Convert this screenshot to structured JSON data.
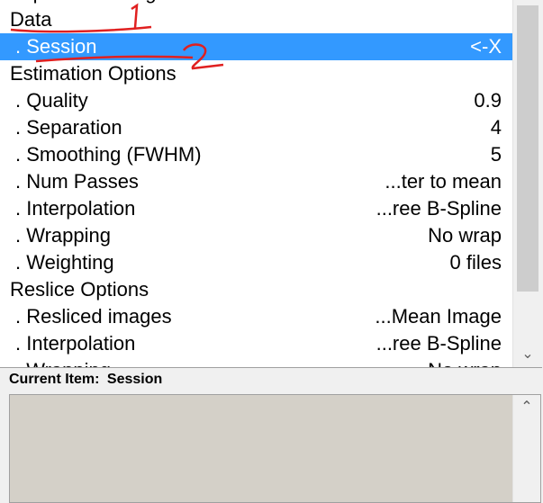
{
  "list": {
    "rows": [
      {
        "label": "Expected Changes",
        "value": "",
        "type": "header"
      },
      {
        "label": "Data",
        "value": "",
        "type": "header"
      },
      {
        "label": ". Session",
        "value": "<-X",
        "type": "sub",
        "selected": true
      },
      {
        "label": "Estimation Options",
        "value": "",
        "type": "header"
      },
      {
        "label": ". Quality",
        "value": "0.9",
        "type": "sub"
      },
      {
        "label": ". Separation",
        "value": "4",
        "type": "sub"
      },
      {
        "label": ". Smoothing (FWHM)",
        "value": "5",
        "type": "sub"
      },
      {
        "label": ". Num Passes",
        "value": "...ter to mean",
        "type": "sub"
      },
      {
        "label": ". Interpolation",
        "value": "...ree B-Spline",
        "type": "sub"
      },
      {
        "label": ". Wrapping",
        "value": "No wrap",
        "type": "sub"
      },
      {
        "label": ". Weighting",
        "value": "0 files",
        "type": "sub"
      },
      {
        "label": "Reslice Options",
        "value": "",
        "type": "header"
      },
      {
        "label": ". Resliced images",
        "value": "...Mean Image",
        "type": "sub"
      },
      {
        "label": ". Interpolation",
        "value": "...ree B-Spline",
        "type": "sub"
      },
      {
        "label": ". Wrapping",
        "value": "No wrap",
        "type": "sub"
      }
    ]
  },
  "current_item": {
    "label": "Current Item:",
    "value": "Session"
  },
  "annotations": {
    "mark1": "1",
    "mark2": "2",
    "color": "#e02020"
  },
  "icons": {
    "scroll_down": "chevron-down-icon",
    "scroll_up": "chevron-up-icon"
  },
  "colors": {
    "selection": "#3399ff",
    "textarea_bg": "#d4d0c8"
  }
}
